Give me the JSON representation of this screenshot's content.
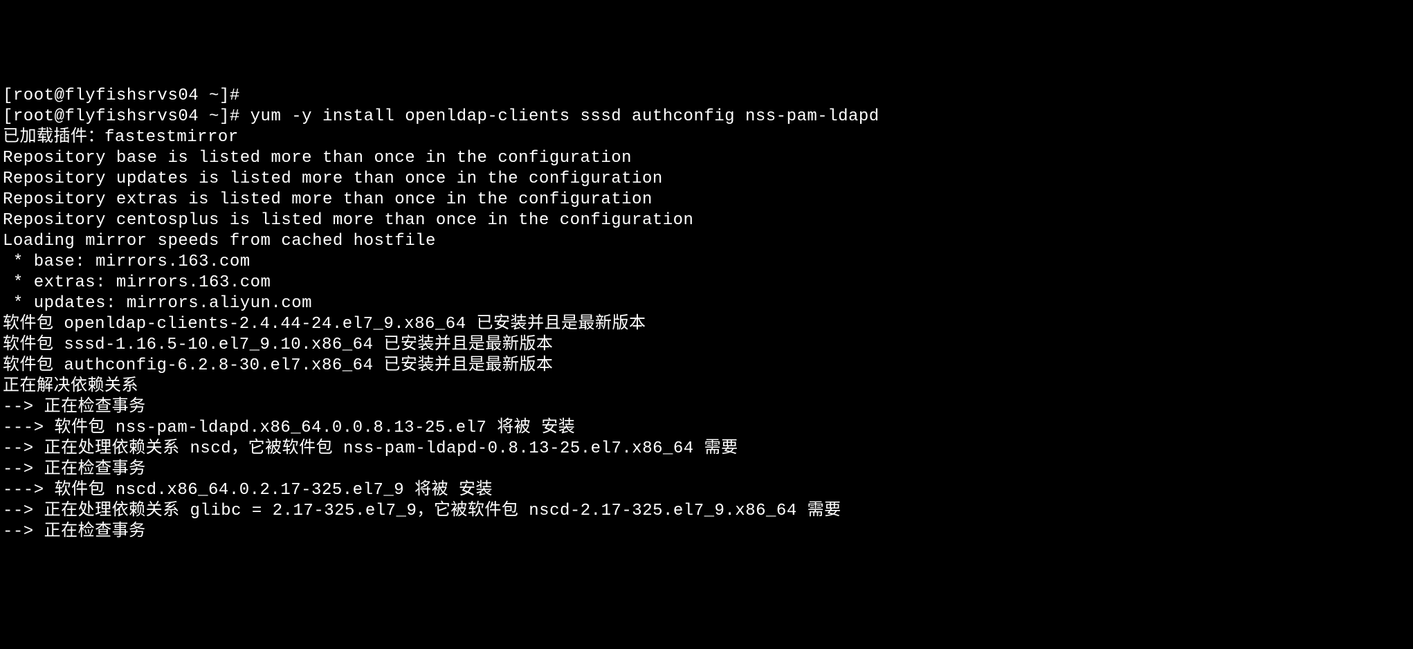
{
  "terminal": {
    "lines": [
      "[root@flyfishsrvs04 ~]#",
      "[root@flyfishsrvs04 ~]# yum -y install openldap-clients sssd authconfig nss-pam-ldapd",
      "已加载插件：fastestmirror",
      "Repository base is listed more than once in the configuration",
      "Repository updates is listed more than once in the configuration",
      "Repository extras is listed more than once in the configuration",
      "Repository centosplus is listed more than once in the configuration",
      "Loading mirror speeds from cached hostfile",
      " * base: mirrors.163.com",
      " * extras: mirrors.163.com",
      " * updates: mirrors.aliyun.com",
      "软件包 openldap-clients-2.4.44-24.el7_9.x86_64 已安装并且是最新版本",
      "软件包 sssd-1.16.5-10.el7_9.10.x86_64 已安装并且是最新版本",
      "软件包 authconfig-6.2.8-30.el7.x86_64 已安装并且是最新版本",
      "正在解决依赖关系",
      "--> 正在检查事务",
      "---> 软件包 nss-pam-ldapd.x86_64.0.0.8.13-25.el7 将被 安装",
      "--> 正在处理依赖关系 nscd，它被软件包 nss-pam-ldapd-0.8.13-25.el7.x86_64 需要",
      "--> 正在检查事务",
      "---> 软件包 nscd.x86_64.0.2.17-325.el7_9 将被 安装",
      "--> 正在处理依赖关系 glibc = 2.17-325.el7_9，它被软件包 nscd-2.17-325.el7_9.x86_64 需要",
      "--> 正在检查事务"
    ]
  }
}
